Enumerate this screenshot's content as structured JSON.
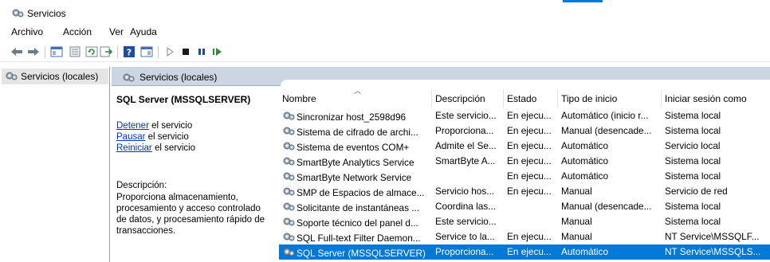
{
  "window": {
    "title": "Servicios"
  },
  "menu": [
    "Archivo",
    "Acción",
    "Ver",
    "Ayuda"
  ],
  "tree": {
    "root_label": "Servicios (locales)"
  },
  "panel": {
    "header": "Servicios (locales)"
  },
  "detail": {
    "service_title": "SQL Server (MSSQLSERVER)",
    "actions": [
      {
        "link": "Detener",
        "rest": " el servicio"
      },
      {
        "link": "Pausar",
        "rest": " el servicio"
      },
      {
        "link": "Reiniciar",
        "rest": " el servicio"
      }
    ],
    "description_label": "Descripción:",
    "description": "Proporciona almacenamiento, procesamiento y acceso controlado de datos, y procesamiento rápido de transacciones."
  },
  "columns": [
    "Nombre",
    "Descripción",
    "Estado",
    "Tipo de inicio",
    "Iniciar sesión como"
  ],
  "rows": [
    {
      "name": "Sincronizar host_2598d96",
      "desc": "Este servicio...",
      "state": "En ejecu...",
      "start": "Automático (inicio r...",
      "logon": "Sistema local"
    },
    {
      "name": "Sistema de cifrado de archi...",
      "desc": "Proporciona...",
      "state": "En ejecu...",
      "start": "Manual (desencade...",
      "logon": "Sistema local"
    },
    {
      "name": "Sistema de eventos COM+",
      "desc": "Admite el Se...",
      "state": "En ejecu...",
      "start": "Automático",
      "logon": "Servicio local"
    },
    {
      "name": "SmartByte Analytics Service",
      "desc": "SmartByte A...",
      "state": "En ejecu...",
      "start": "Automático",
      "logon": "Sistema local"
    },
    {
      "name": "SmartByte Network Service",
      "desc": "",
      "state": "En ejecu...",
      "start": "Automático",
      "logon": "Sistema local"
    },
    {
      "name": "SMP de Espacios de almace...",
      "desc": "Servicio hos...",
      "state": "En ejecu...",
      "start": "Manual",
      "logon": "Servicio de red"
    },
    {
      "name": "Solicitante de instantáneas ...",
      "desc": "Coordina las...",
      "state": "",
      "start": "Manual (desencade...",
      "logon": "Sistema local"
    },
    {
      "name": "Soporte técnico del panel d...",
      "desc": "Este servicio...",
      "state": "",
      "start": "Manual",
      "logon": "Sistema local"
    },
    {
      "name": "SQL Full-text Filter Daemon...",
      "desc": "Service to la...",
      "state": "En ejecu...",
      "start": "Manual",
      "logon": "NT Service\\MSSQLF..."
    },
    {
      "name": "SQL Server (MSSQLSERVER)",
      "desc": "Proporciona...",
      "state": "En ejecu...",
      "start": "Automático",
      "logon": "NT Service\\MSSQLS..."
    }
  ],
  "selected_row": 9,
  "colors": {
    "selection": "#0078d7",
    "link": "#0033cc",
    "header_bg": "#cbd6e2"
  }
}
